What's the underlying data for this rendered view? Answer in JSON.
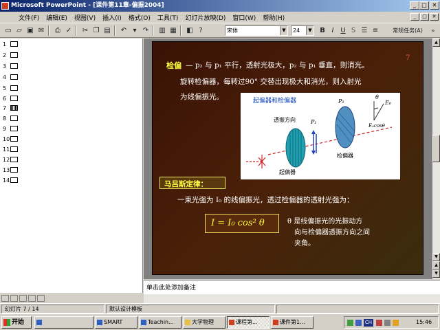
{
  "window": {
    "title": "Microsoft PowerPoint - [课件第11章-偏振2004]",
    "minimize_glyph": "_",
    "restore_glyph": "□",
    "close_glyph": "✕"
  },
  "menu": {
    "items": [
      "文件(F)",
      "编辑(E)",
      "视图(V)",
      "插入(I)",
      "格式(O)",
      "工具(T)",
      "幻灯片放映(D)",
      "窗口(W)",
      "帮助(H)"
    ]
  },
  "toolbar": {
    "font_name": "宋体",
    "font_size": "24",
    "bold_label": "B",
    "italic_label": "I",
    "underline_label": "U",
    "shadow_label": "S",
    "common_tasks_label": "常规任务(A)"
  },
  "outline": {
    "slides": [
      {
        "number": "1",
        "current": false
      },
      {
        "number": "2",
        "current": false
      },
      {
        "number": "3",
        "current": false
      },
      {
        "number": "4",
        "current": false
      },
      {
        "number": "5",
        "current": false
      },
      {
        "number": "6",
        "current": false
      },
      {
        "number": "7",
        "current": true
      },
      {
        "number": "8",
        "current": false
      },
      {
        "number": "9",
        "current": false
      },
      {
        "number": "10",
        "current": false
      },
      {
        "number": "11",
        "current": false
      },
      {
        "number": "12",
        "current": false
      },
      {
        "number": "13",
        "current": false
      },
      {
        "number": "14",
        "current": false
      }
    ]
  },
  "slide": {
    "page_number": "7",
    "line1_keyword": "检偏",
    "line1_text": "— p₂ 与 p₁ 平行，透射光极大，p₂ 与 p₁ 垂直，则消光。",
    "line2_text": "旋转检偏器，每转过90° 交替出现极大和消光，则入射光",
    "line3_text": "为线偏振光。",
    "figure": {
      "title": "起偏器和检偏器",
      "label_direction": "透振方向",
      "label_p1": "P₁",
      "label_p2": "P₂",
      "label_theta": "θ",
      "label_e0": "E₀",
      "label_ecos": "E₀cosθ",
      "label_polarizer": "起偏器",
      "label_analyzer": "检偏器"
    },
    "malus_heading": "马吕斯定律：",
    "malus_text": "一束光强为 I₀ 的线偏振光，透过检偏器的透射光强为：",
    "formula": "I = I₀ cos² θ",
    "note_line1": "θ 是线偏振光的光振动方",
    "note_line2": "向与检偏器透振方向之间",
    "note_line3": "夹角。"
  },
  "notes": {
    "placeholder": "单击此处添加备注"
  },
  "statusbar": {
    "slide_counter": "幻灯片 7 / 14",
    "design_template": "默认设计模板"
  },
  "taskbar": {
    "start_label": "开始",
    "tasks": [
      {
        "label": "",
        "active": false
      },
      {
        "label": "SMART",
        "active": false
      },
      {
        "label": "Teachin...",
        "active": false
      },
      {
        "label": "大学物理",
        "active": false
      },
      {
        "label": "课程第...",
        "active": true
      },
      {
        "label": "课件第1...",
        "active": false
      }
    ],
    "tray_ime": "CH",
    "clock": "15:46"
  },
  "colors": {
    "title_bar_start": "#0a246a",
    "slide_background": "#3a1206",
    "slide_keyword": "#ffff40",
    "slide_text": "#ffffff",
    "heading_box": "#f0f060"
  }
}
